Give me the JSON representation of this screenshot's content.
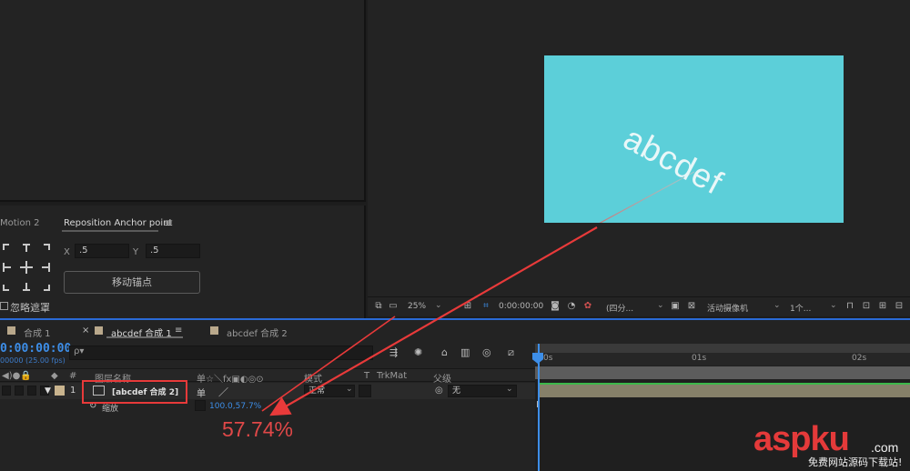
{
  "comp_text": "abcdef",
  "motion_panel": {
    "tab_motion": "Motion 2",
    "tab_reposition": "Reposition Anchor point",
    "tab_menu_icon": "menu-icon",
    "x_label": "X",
    "x_value": ".5",
    "y_label": "Y",
    "y_value": ".5",
    "move_anchor_button": "移动锚点",
    "ignore_mask_label": "忽略遮罩"
  },
  "viewer_toolbar": {
    "zoom": "25%",
    "timecode": "0:00:00:00",
    "resolution": "(四分...",
    "camera": "活动摄像机",
    "views": "1个..."
  },
  "timeline": {
    "tabs": [
      {
        "label": "合成 1"
      },
      {
        "label": "abcdef 合成 1"
      },
      {
        "label": "abcdef 合成 2"
      }
    ],
    "tab_close": "×",
    "tab_menu": "≡",
    "current_time": "0:00:00:00",
    "fps": "00000 (25.00 fps)",
    "search_placeholder": "ρ▾",
    "headers": {
      "hash": "#",
      "layer_name": "图层名称",
      "switches": "单☆＼fx▣◐◎⊙",
      "mode": "模式",
      "t": "T",
      "trkmat": "TrkMat",
      "parent": "父级"
    },
    "layer": {
      "index": "1",
      "name": "[abcdef 合成 2]",
      "mode": "正常",
      "parent": "无"
    },
    "property": {
      "name": "缩放",
      "value": "100.0,57.7%"
    },
    "ruler": {
      "start": "0s",
      "mark1": "01s",
      "mark2": "02s"
    }
  },
  "annotation": {
    "percent": "57.74%"
  },
  "watermark": {
    "logo_a": "asp",
    "logo_b": "ku",
    "com": ".com",
    "sub": "免费网站源码下载站!"
  },
  "colors": {
    "accent_blue": "#3d8ee8",
    "annotation_red": "#e83a3a",
    "comp_bg": "#5ccfd9"
  }
}
